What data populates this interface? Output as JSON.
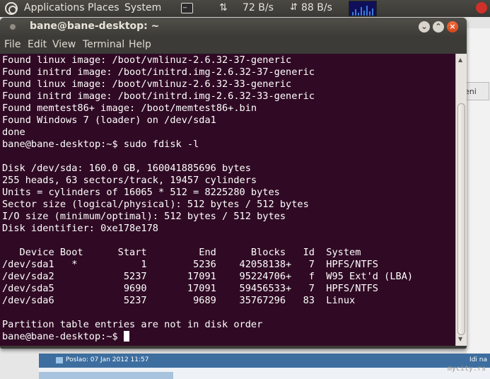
{
  "panel": {
    "applications": "Applications",
    "places": "Places",
    "system": "System",
    "net_up": "72 B/s",
    "net_down": "88 B/s"
  },
  "window": {
    "title": "bane@bane-desktop: ~"
  },
  "menu": {
    "file": "File",
    "edit": "Edit",
    "view": "View",
    "terminal": "Terminal",
    "help": "Help"
  },
  "terminal": {
    "lines": [
      "Found linux image: /boot/vmlinuz-2.6.32-37-generic",
      "Found initrd image: /boot/initrd.img-2.6.32-37-generic",
      "Found linux image: /boot/vmlinuz-2.6.32-33-generic",
      "Found initrd image: /boot/initrd.img-2.6.32-33-generic",
      "Found memtest86+ image: /boot/memtest86+.bin",
      "Found Windows 7 (loader) on /dev/sda1",
      "done",
      "bane@bane-desktop:~$ sudo fdisk -l",
      "",
      "Disk /dev/sda: 160.0 GB, 160041885696 bytes",
      "255 heads, 63 sectors/track, 19457 cylinders",
      "Units = cylinders of 16065 * 512 = 8225280 bytes",
      "Sector size (logical/physical): 512 bytes / 512 bytes",
      "I/O size (minimum/optimal): 512 bytes / 512 bytes",
      "Disk identifier: 0xe178e178",
      "",
      "   Device Boot      Start         End      Blocks   Id  System",
      "/dev/sda1   *           1        5236    42058138+   7  HPFS/NTFS",
      "/dev/sda2            5237       17091    95224706+   f  W95 Ext'd (LBA)",
      "/dev/sda5            9690       17091    59456533+   7  HPFS/NTFS",
      "/dev/sda6            5237        9689    35767296   83  Linux",
      "",
      "Partition table entries are not in disk order"
    ],
    "prompt": "bane@bane-desktop:~$ "
  },
  "background": {
    "button_label": "eni",
    "post_label": "Poslao: 07 Jan 2012 11:57",
    "post_right": "Idi na",
    "watermark": "mycity.rs"
  }
}
